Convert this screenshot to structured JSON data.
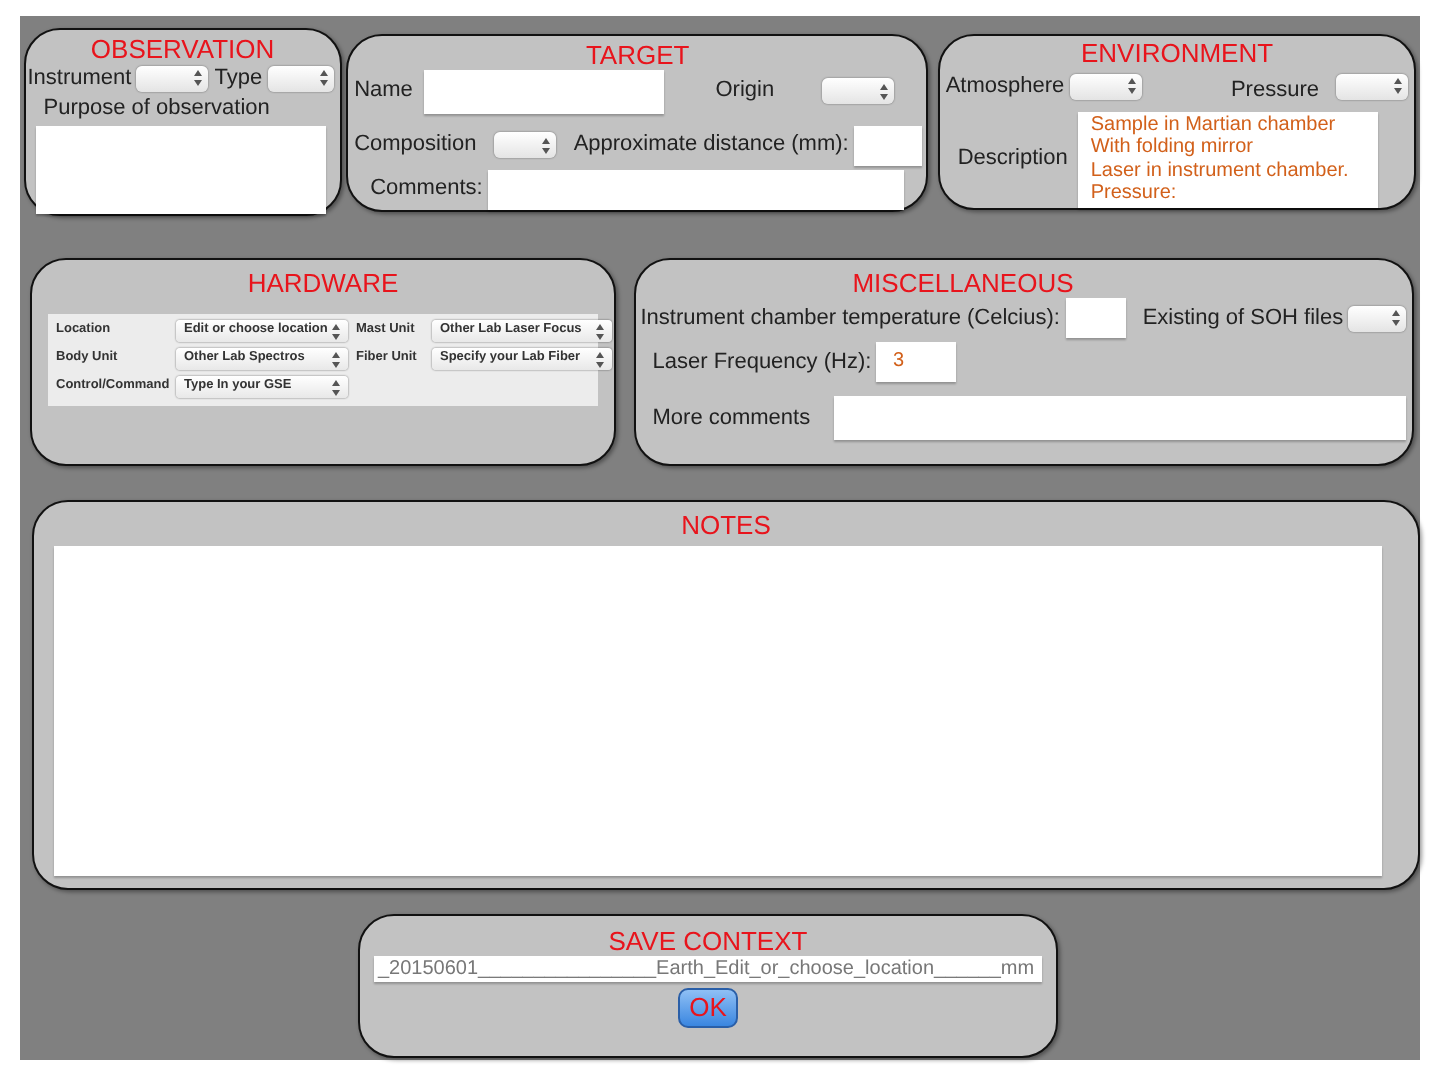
{
  "observation": {
    "title": "OBSERVATION",
    "instrument_label": "Instrument",
    "type_label": "Type",
    "purpose_label": "Purpose of observation"
  },
  "target": {
    "title": "TARGET",
    "name_label": "Name",
    "origin_label": "Origin",
    "composition_label": "Composition",
    "distance_label": "Approximate distance (mm):",
    "comments_label": "Comments:"
  },
  "environment": {
    "title": "ENVIRONMENT",
    "atmosphere_label": "Atmosphere",
    "pressure_label": "Pressure",
    "description_label": "Description",
    "description_lines": [
      "Sample in Martian chamber",
      "With folding mirror",
      "Laser in instrument chamber.",
      "Pressure:"
    ]
  },
  "hardware": {
    "title": "HARDWARE",
    "rows": [
      {
        "label": "Location",
        "value": "Edit or choose location"
      },
      {
        "label": "Mast Unit",
        "value": "Other Lab Laser Focus"
      },
      {
        "label": "Body Unit",
        "value": "Other Lab Spectros"
      },
      {
        "label": "Fiber Unit",
        "value": "Specify your Lab Fiber"
      },
      {
        "label": "Control/Command",
        "value": "Type In your GSE"
      }
    ]
  },
  "miscellaneous": {
    "title": "MISCELLANEOUS",
    "temperature_label": "Instrument chamber temperature (Celcius):",
    "soh_label": "Existing of SOH files",
    "frequency_label": "Laser Frequency (Hz):",
    "frequency_value": "3",
    "comments_label": "More comments"
  },
  "notes": {
    "title": "NOTES"
  },
  "save_context": {
    "title": "SAVE CONTEXT",
    "path": "_20150601________________Earth_Edit_or_choose_location______mm",
    "button": "OK"
  }
}
